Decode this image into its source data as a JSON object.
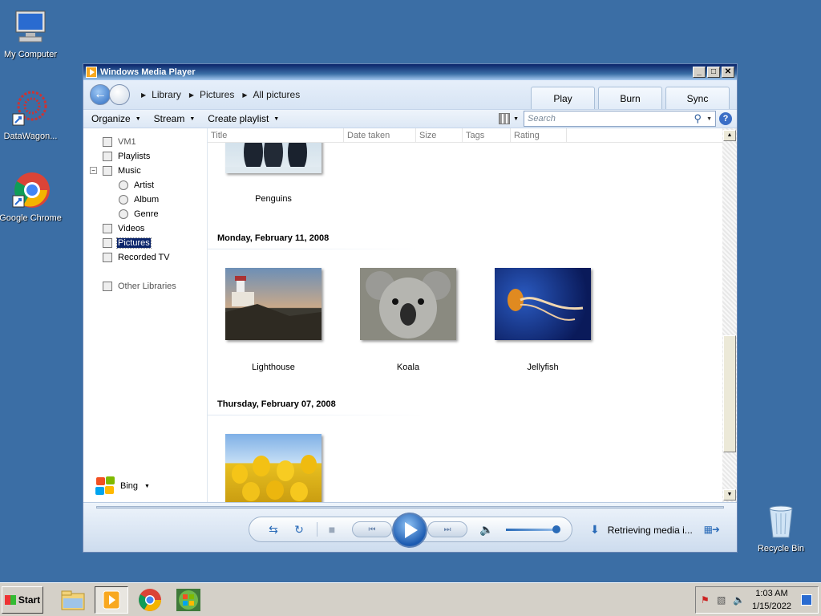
{
  "desktop": {
    "icons": [
      {
        "label": "My Computer"
      },
      {
        "label": "DataWagon..."
      },
      {
        "label": "Google Chrome"
      },
      {
        "label": "Recycle Bin"
      }
    ]
  },
  "window": {
    "title": "Windows Media Player",
    "controls": {
      "minimize": "_",
      "maximize": "□",
      "close": "✕"
    }
  },
  "breadcrumb": [
    "Library",
    "Pictures",
    "All pictures"
  ],
  "tabs": [
    "Play",
    "Burn",
    "Sync"
  ],
  "toolbar": {
    "organize": "Organize",
    "stream": "Stream",
    "create_playlist": "Create playlist",
    "search_placeholder": "Search",
    "help": "?"
  },
  "nav": {
    "items": [
      {
        "label": "VM1"
      },
      {
        "label": "Playlists"
      },
      {
        "label": "Music"
      },
      {
        "label": "Artist"
      },
      {
        "label": "Album"
      },
      {
        "label": "Genre"
      },
      {
        "label": "Videos"
      },
      {
        "label": "Pictures"
      },
      {
        "label": "Recorded TV"
      },
      {
        "label": "Other Libraries"
      }
    ],
    "bing": "Bing"
  },
  "columns": [
    "Title",
    "Date taken",
    "Size",
    "Tags",
    "Rating"
  ],
  "groups": [
    {
      "label": "Monday, February 11, 2008"
    },
    {
      "label": "Thursday, February 07, 2008"
    }
  ],
  "pictures": [
    {
      "title": "Penguins"
    },
    {
      "title": "Lighthouse"
    },
    {
      "title": "Koala"
    },
    {
      "title": "Jellyfish"
    },
    {
      "title": ""
    }
  ],
  "player": {
    "status": "Retrieving media i..."
  },
  "taskbar": {
    "start": "Start",
    "time": "1:03 AM",
    "date": "1/15/2022"
  }
}
